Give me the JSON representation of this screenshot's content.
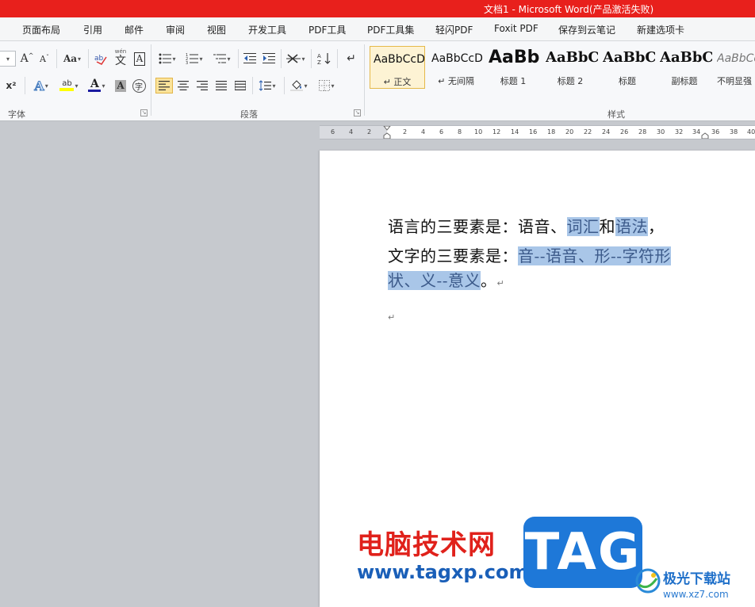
{
  "window": {
    "title": "文档1 - Microsoft Word(产品激活失败)"
  },
  "menu": {
    "tabs": [
      "页面布局",
      "引用",
      "邮件",
      "审阅",
      "视图",
      "开发工具",
      "PDF工具",
      "PDF工具集",
      "轻闪PDF",
      "Foxit PDF",
      "保存到云笔记",
      "新建选项卡"
    ]
  },
  "ribbon": {
    "font_group_label": "字体",
    "paragraph_group_label": "段落",
    "styles_group_label": "样式",
    "font": {
      "grow_label": "A",
      "shrink_label": "A",
      "case_label": "Aa",
      "superscript_label": "x²",
      "pinyin_label": "wén",
      "pinyin_char": "文",
      "border_char_label": "A",
      "shading_char_label": "A",
      "enclose_char_label": "字",
      "font_color_label": "A",
      "highlight_label": "ab"
    },
    "styles": [
      {
        "sample": "AaBbCcD",
        "name": "↵ 正文",
        "selected": true
      },
      {
        "sample": "AaBbCcD",
        "name": "↵ 无间隔",
        "selected": false
      },
      {
        "sample": "AaBb",
        "name": "标题 1",
        "selected": false
      },
      {
        "sample": "AaBbC",
        "name": "标题 2",
        "selected": false
      },
      {
        "sample": "AaBbC",
        "name": "标题",
        "selected": false
      },
      {
        "sample": "AaBbC",
        "name": "副标题",
        "selected": false
      },
      {
        "sample": "AaBbCc",
        "name": "不明显强",
        "selected": false
      }
    ]
  },
  "ruler": {
    "numbers": [
      "6",
      "4",
      "2",
      "2",
      "4",
      "6",
      "8",
      "10",
      "12",
      "14",
      "16",
      "18",
      "20",
      "22",
      "24",
      "26",
      "28",
      "30",
      "32",
      "34",
      "36",
      "38",
      "40"
    ]
  },
  "document": {
    "line1_a": "语言的三要素是：语音、",
    "line1_b": "词汇",
    "line1_c": "和",
    "line1_d": "语法",
    "line1_e": "，",
    "line2_a": "文字的三要素是：",
    "line2_b": "音--语音、形--字符形",
    "line3_a": "状、义--意义",
    "line3_b": "。",
    "para_mark": "↵",
    "empty_para_mark": "↵"
  },
  "watermark": {
    "cn_text": "电脑技术网",
    "url": "www.tagxp.com",
    "tag": "TAG",
    "site_name": "极光下载站",
    "site_url": "www.xz7.com"
  },
  "colors": {
    "title_bar": "#e8201c",
    "selection": "#a9c6e8",
    "watermark_red": "#e0211b",
    "watermark_blue": "#1e78d8"
  }
}
